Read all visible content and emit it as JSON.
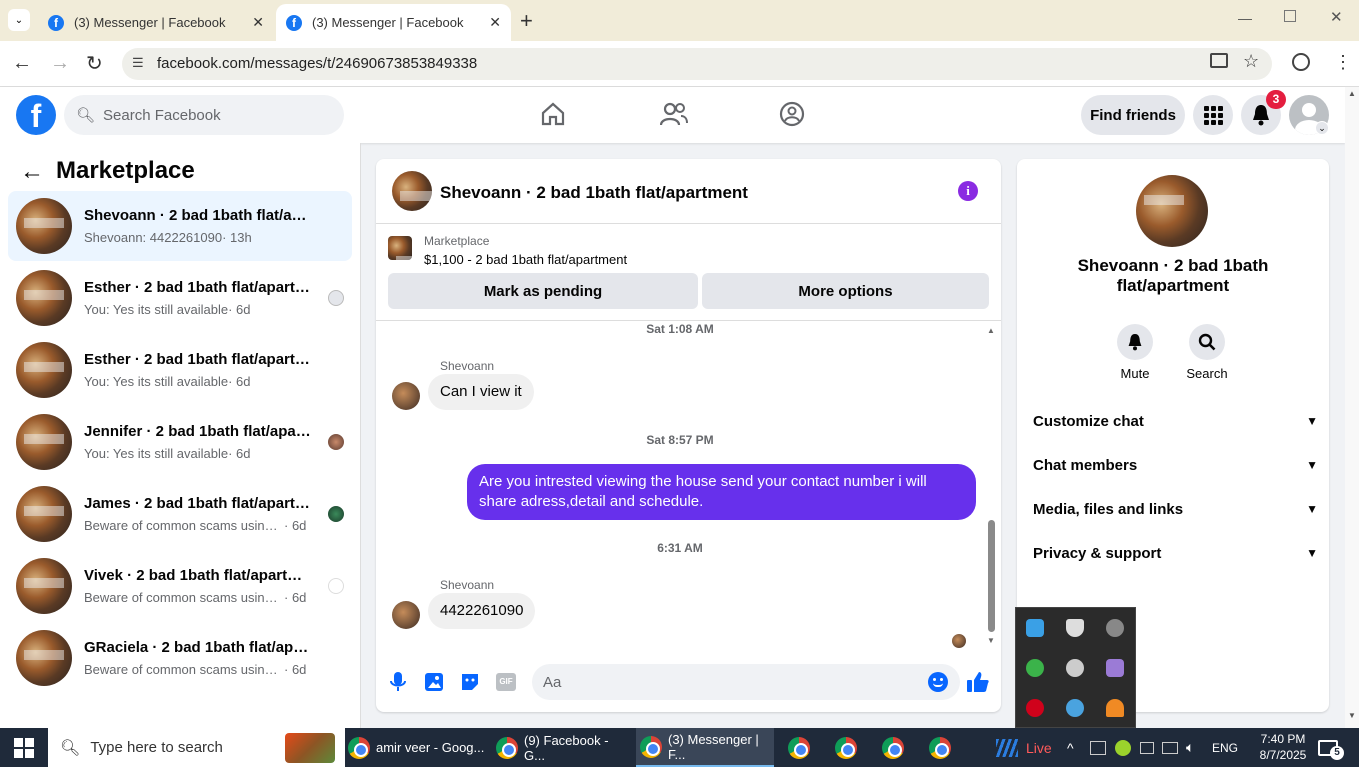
{
  "browser": {
    "tabs": [
      {
        "title": "(3) Messenger | Facebook"
      },
      {
        "title": "(3) Messenger | Facebook"
      }
    ],
    "url": "facebook.com/messages/t/24690673853849338"
  },
  "fb_header": {
    "search_placeholder": "Search Facebook",
    "find_friends": "Find friends",
    "notification_count": "3"
  },
  "sidebar": {
    "title": "Marketplace",
    "conversations": [
      {
        "name": "Shevoann · 2 bad 1bath flat/apart...",
        "preview": "Shevoann: 4422261090",
        "time": "· 13h"
      },
      {
        "name": "Esther · 2 bad 1bath flat/apartm...",
        "preview": "You: Yes its still available",
        "time": "· 6d"
      },
      {
        "name": "Esther · 2 bad 1bath flat/apartment",
        "preview": "You: Yes its still available",
        "time": "· 6d"
      },
      {
        "name": "Jennifer · 2 bad 1bath flat/apart...",
        "preview": "You: Yes its still available",
        "time": "· 6d"
      },
      {
        "name": "James · 2 bad 1bath flat/apartm...",
        "preview": "Beware of common scams using p...",
        "time": "· 6d"
      },
      {
        "name": "Vivek · 2 bad 1bath flat/apartment",
        "preview": "Beware of common scams using p...",
        "time": "· 6d"
      },
      {
        "name": "GRaciela · 2 bad 1bath flat/apartm...",
        "preview": "Beware of common scams using pay...",
        "time": "· 6d"
      }
    ]
  },
  "chat": {
    "title": "Shevoann · 2 bad 1bath flat/apartment",
    "listing_source": "Marketplace",
    "listing": "$1,100 - 2 bad 1bath flat/apartment",
    "mark_pending": "Mark as pending",
    "more_options": "More options",
    "messages": [
      {
        "type": "timestamp",
        "text": "Sat 1:08 AM"
      },
      {
        "type": "received",
        "sender": "Shevoann",
        "text": "Can I view it"
      },
      {
        "type": "timestamp",
        "text": "Sat 8:57 PM"
      },
      {
        "type": "sent",
        "text": "Are you intrested viewing the house send your contact number i will share adress,detail and schedule."
      },
      {
        "type": "timestamp",
        "text": "6:31 AM"
      },
      {
        "type": "received",
        "sender": "Shevoann",
        "text": "4422261090"
      }
    ],
    "composer_placeholder": "Aa",
    "gif_label": "GIF"
  },
  "details": {
    "name": "Shevoann · 2 bad 1bath flat/apartment",
    "mute": "Mute",
    "search": "Search",
    "sections": [
      "Customize chat",
      "Chat members",
      "Media, files and links",
      "Privacy & support"
    ]
  },
  "taskbar": {
    "search_placeholder": "Type here to search",
    "apps": [
      {
        "label": "amir veer - Goog..."
      },
      {
        "label": "(9) Facebook - G..."
      },
      {
        "label": "(3) Messenger | F..."
      }
    ],
    "live": "Live",
    "lang": "ENG",
    "time": "7:40 PM",
    "date": "8/7/2025",
    "notif_count": "5"
  },
  "colors": {
    "brand": "#1877f2",
    "sent_bubble": "#6730ec",
    "tabbar": "#f1ecd9",
    "taskbar": "#1f2a3a"
  }
}
